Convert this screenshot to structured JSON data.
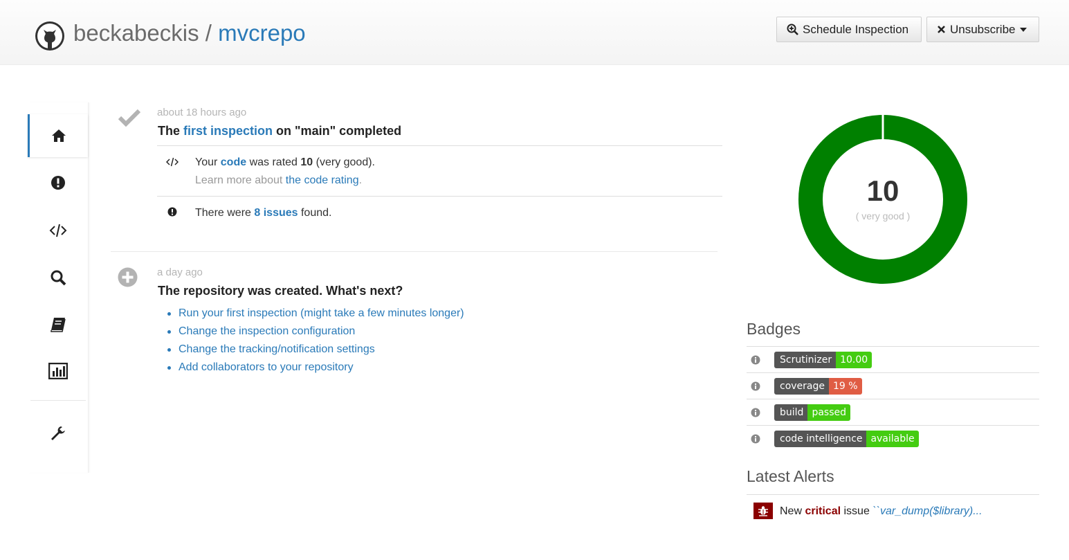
{
  "header": {
    "owner": "beckabeckis",
    "separator": " / ",
    "repo": "mvcrepo",
    "schedule_label": "Schedule Inspection",
    "unsubscribe_label": "Unsubscribe"
  },
  "sidebar": {
    "items": [
      {
        "name": "home-icon",
        "active": true
      },
      {
        "name": "issues-icon",
        "active": false
      },
      {
        "name": "code-icon",
        "active": false
      },
      {
        "name": "search-icon",
        "active": false
      },
      {
        "name": "book-icon",
        "active": false
      },
      {
        "name": "statistics-icon",
        "active": false
      },
      {
        "name": "wrench-icon",
        "active": false
      }
    ]
  },
  "events": {
    "inspection": {
      "timeago": "about 18 hours ago",
      "title_prefix": "The ",
      "title_link": "first inspection",
      "title_suffix": " on \"main\" completed",
      "rating_prefix": "Your ",
      "rating_link": "code",
      "rating_mid": " was rated ",
      "rating_value": "10",
      "rating_suffix": " (very good).",
      "learn_prefix": "Learn more about ",
      "learn_link": "the code rating",
      "learn_suffix": ".",
      "issues_prefix": "There were ",
      "issues_link": "8 issues",
      "issues_suffix": " found."
    },
    "created": {
      "timeago": "a day ago",
      "title": "The repository was created. What's next?",
      "next_steps": [
        "Run your first inspection (might take a few minutes longer)",
        "Change the inspection configuration",
        "Change the tracking/notification settings",
        "Add collaborators to your repository"
      ]
    }
  },
  "rating": {
    "value": "10",
    "label": "( very good )",
    "fraction": 1.0,
    "color": "#008000"
  },
  "badges": {
    "title": "Badges",
    "items": [
      {
        "label": "Scrutinizer",
        "value": "10.00",
        "color": "#4c1"
      },
      {
        "label": "coverage",
        "value": "19 %",
        "color": "#e05d44"
      },
      {
        "label": "build",
        "value": "passed",
        "color": "#4c1"
      },
      {
        "label": "code intelligence",
        "value": "available",
        "color": "#4c1"
      }
    ]
  },
  "alerts": {
    "title": "Latest Alerts",
    "items": [
      {
        "prefix": "New ",
        "severity": "critical",
        "middle": " issue ",
        "link": "``var_dump($library)..."
      }
    ]
  }
}
